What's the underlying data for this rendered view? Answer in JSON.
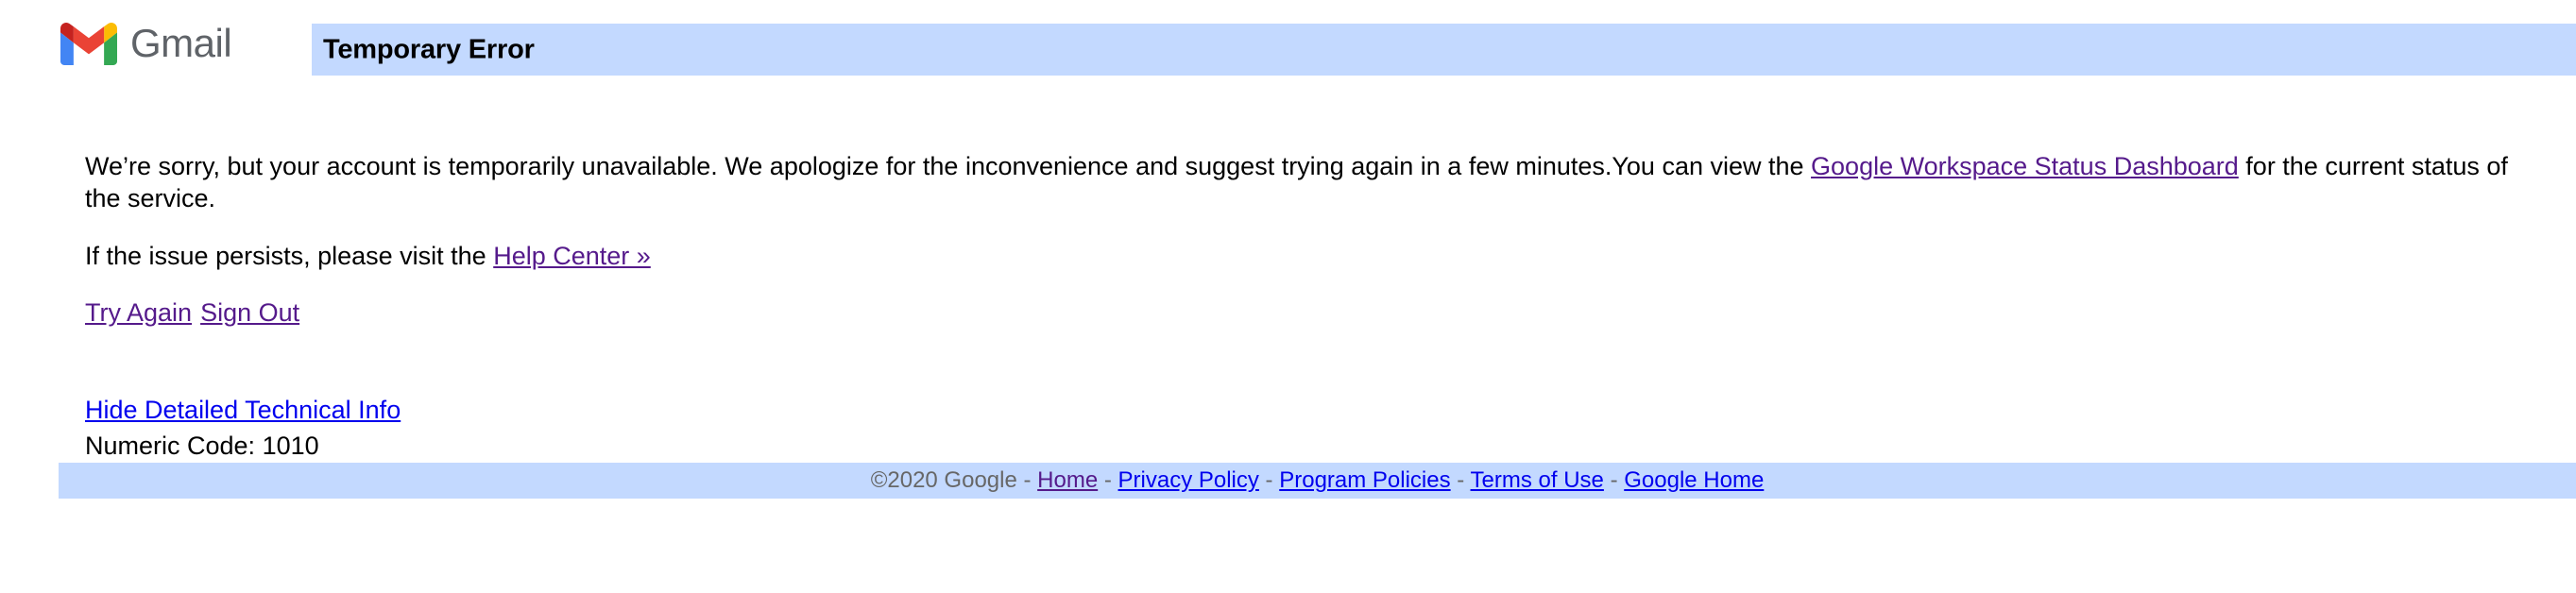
{
  "header": {
    "logo_icon": "gmail-m-logo-icon",
    "wordmark": "Gmail",
    "logo_colors": {
      "red": "#ea4335",
      "dark_red": "#c5221f",
      "blue": "#4285f4",
      "yellow": "#fbbc04",
      "green": "#34a853",
      "wordmark_gray": "#5f6368"
    },
    "bar_title": "Temporary Error",
    "bar_color": "#c3d9ff"
  },
  "main": {
    "paragraph1": {
      "text_before_link": "We’re sorry, but your account is temporarily unavailable. We apologize for the inconvenience and suggest trying again in a few minutes.You can view the ",
      "link_label": "Google Workspace Status Dashboard",
      "text_after_link": " for the current status of the service."
    },
    "paragraph2": {
      "text_before_link": "If the issue persists, please visit the ",
      "link_label": "Help Center »",
      "text_after_link": ""
    },
    "actions": {
      "try_again_label": "Try Again",
      "sign_out_label": "Sign Out"
    },
    "details": {
      "toggle_label": "Hide Detailed Technical Info",
      "numeric_code_line": "Numeric Code: 1010"
    },
    "link_colors": {
      "visited": "#551a8b",
      "unvisited": "#0000ee"
    }
  },
  "footer": {
    "copyright": "©2020 Google",
    "separator": " - ",
    "links": [
      {
        "label": "Home",
        "state": "visited"
      },
      {
        "label": "Privacy Policy",
        "state": "unvisited"
      },
      {
        "label": "Program Policies",
        "state": "unvisited"
      },
      {
        "label": "Terms of Use",
        "state": "unvisited"
      },
      {
        "label": "Google Home",
        "state": "unvisited"
      }
    ],
    "bar_color": "#c3d9ff",
    "text_color": "#676767"
  }
}
